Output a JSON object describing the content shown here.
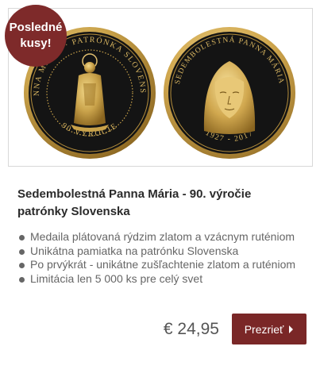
{
  "badge": {
    "line1": "Posledné",
    "line2": "kusy!"
  },
  "product": {
    "title": "Sedembolestná Panna Mária - 90. výročie patrónky Slovenska",
    "features": [
      "Medaila plátovaná rýdzim zlatom a vzácnym ruténiom",
      "Unikátna pamiatka na patrónku Slovenska",
      "Po prvýkrát - unikátne zušľachtenie zlatom a ruténiom",
      "Limitácia len 5 000 ks pre celý svet"
    ],
    "price": "€ 24,95",
    "button_label": "Prezrieť"
  },
  "coins": {
    "front_text_top": "PANNA MÁRIA · PATRÓNKA SLOVENSKA",
    "front_text_bottom": "90 VÝROČIE",
    "back_text_top": "SEDEMBOLESTNÁ PANNA MÁRIA",
    "back_text_bottom": "1927 - 2017"
  },
  "colors": {
    "accent": "#7a2727",
    "gold": "#c9a24a",
    "coin_black": "#141414"
  }
}
